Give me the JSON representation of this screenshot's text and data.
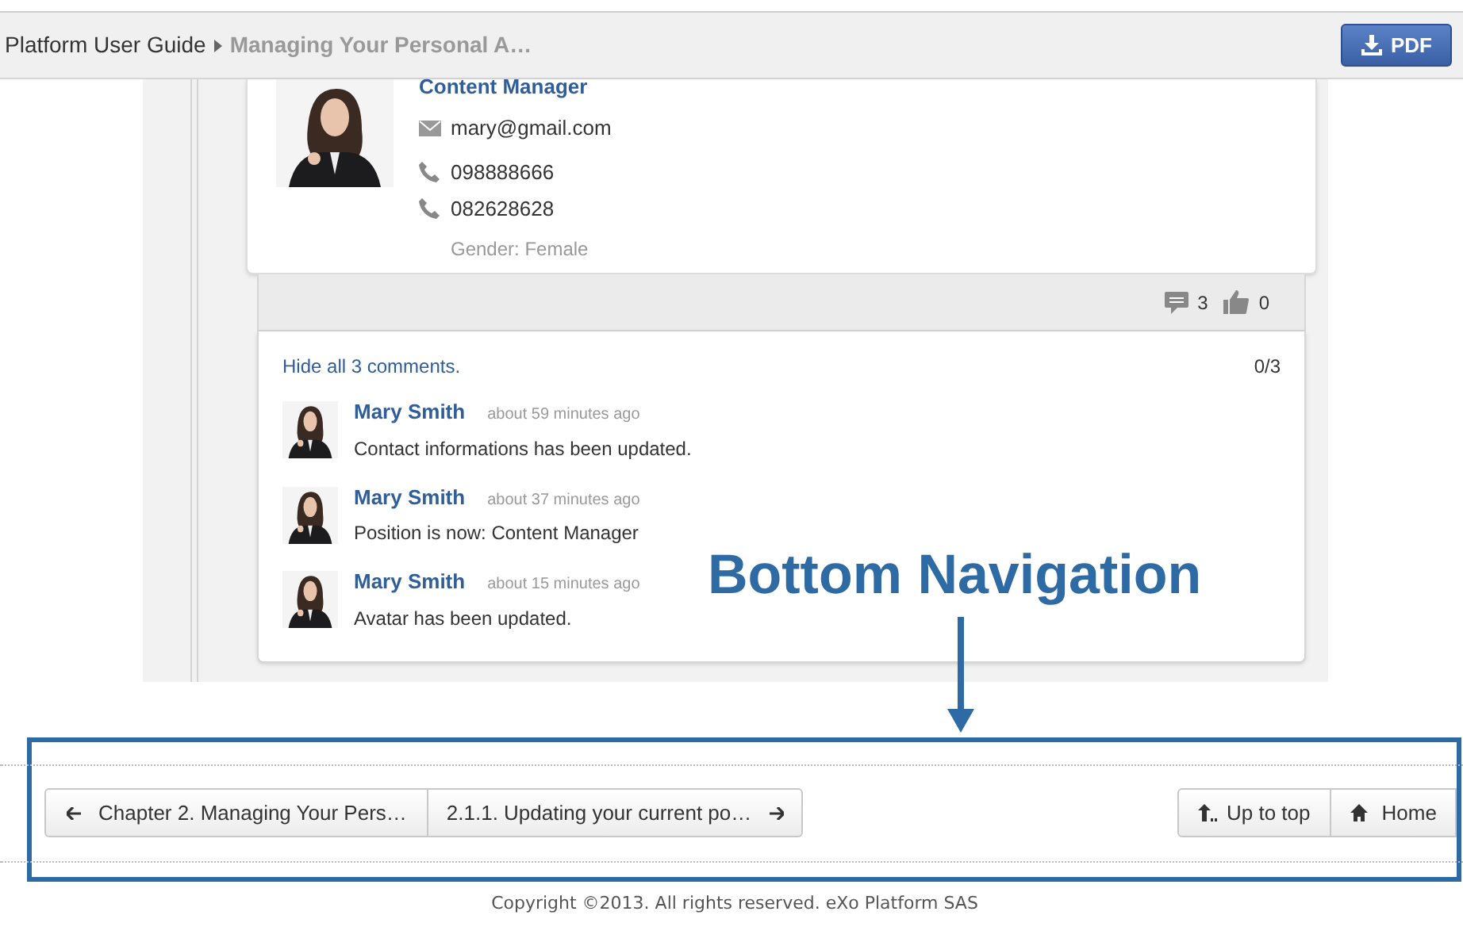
{
  "header": {
    "breadcrumb": [
      {
        "label": "Platform User Guide"
      },
      {
        "label": "Managing Your Personal A…"
      }
    ],
    "pdf_button": "PDF"
  },
  "profile": {
    "position": "Content Manager",
    "email": "mary@gmail.com",
    "phones": [
      "098888666",
      "082628628"
    ],
    "gender": "Gender: Female"
  },
  "activity": {
    "comment_count": "3",
    "like_count": "0",
    "hide_comments": "Hide all 3 comments.",
    "comment_pager": "0/3",
    "comments": [
      {
        "author": "Mary Smith",
        "time": "about 59 minutes ago",
        "text": "Contact informations has been updated."
      },
      {
        "author": "Mary Smith",
        "time": "about 37 minutes ago",
        "text": "Position is now: Content Manager"
      },
      {
        "author": "Mary Smith",
        "time": "about 15 minutes ago",
        "text": "Avatar has been updated."
      }
    ]
  },
  "annotation": {
    "label": "Bottom Navigation"
  },
  "bottom_nav": {
    "previous": "Chapter 2. Managing Your Pers…",
    "next": "2.1.1. Updating your current po…",
    "up": "Up to top",
    "home": "Home"
  },
  "footer": "Copyright ©2013. All rights reserved. eXo Platform SAS"
}
